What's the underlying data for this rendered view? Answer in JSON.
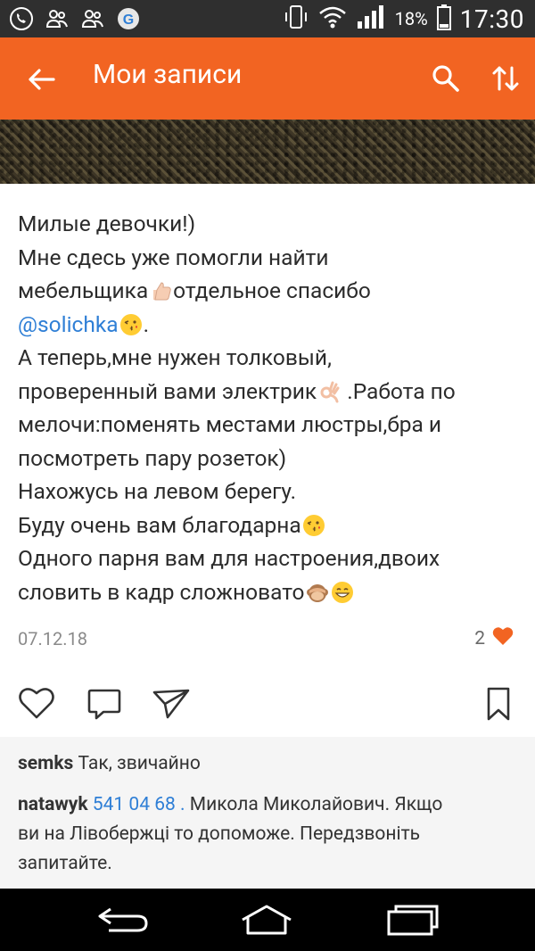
{
  "status_bar": {
    "battery_percent": "18%",
    "time": "17:30",
    "icons": [
      "viber-icon",
      "users-icon",
      "users-icon",
      "app-g-icon",
      "vibrate-icon",
      "wifi-icon",
      "signal-icon",
      "battery-icon"
    ]
  },
  "app_bar": {
    "title": "Мои записи",
    "icons": [
      "back-arrow-icon",
      "search-icon",
      "sort-icon"
    ]
  },
  "post": {
    "caption_lines": [
      "Милые девочки!)",
      "Мне сдесь уже помогли найти",
      "мебельщика",
      "отдельное спасибо",
      "@solichka",
      ".",
      "А теперь,мне нужен толковый,",
      "проверенный вами электрик",
      " .Работа по",
      "мелочи:поменять местами люстры,бра и",
      "посмотреть пару розеток)",
      "Нахожусь на левом берегу.",
      "Буду очень вам благодарна",
      "Одного парня вам для настроения,двоих",
      "словить в кадр сложновато"
    ],
    "date": "07.12.18",
    "like_count": "2",
    "accent_color": "#f26422",
    "mention_color": "#2f7fd6",
    "action_icons": [
      "heart-outline-icon",
      "comment-icon",
      "share-icon",
      "bookmark-icon"
    ]
  },
  "comments": [
    {
      "user": "semks",
      "text": "Так, звичайно"
    },
    {
      "user": "natawyk",
      "phone": "541 04 68 .",
      "text": "Микола Миколайович. Якщо",
      "line2": "ви на Лівобержці то допоможе. Передзвоніть",
      "line3": "запитайте."
    }
  ],
  "nav_bar": {
    "icons": [
      "back-nav-icon",
      "home-icon",
      "recents-icon"
    ]
  }
}
